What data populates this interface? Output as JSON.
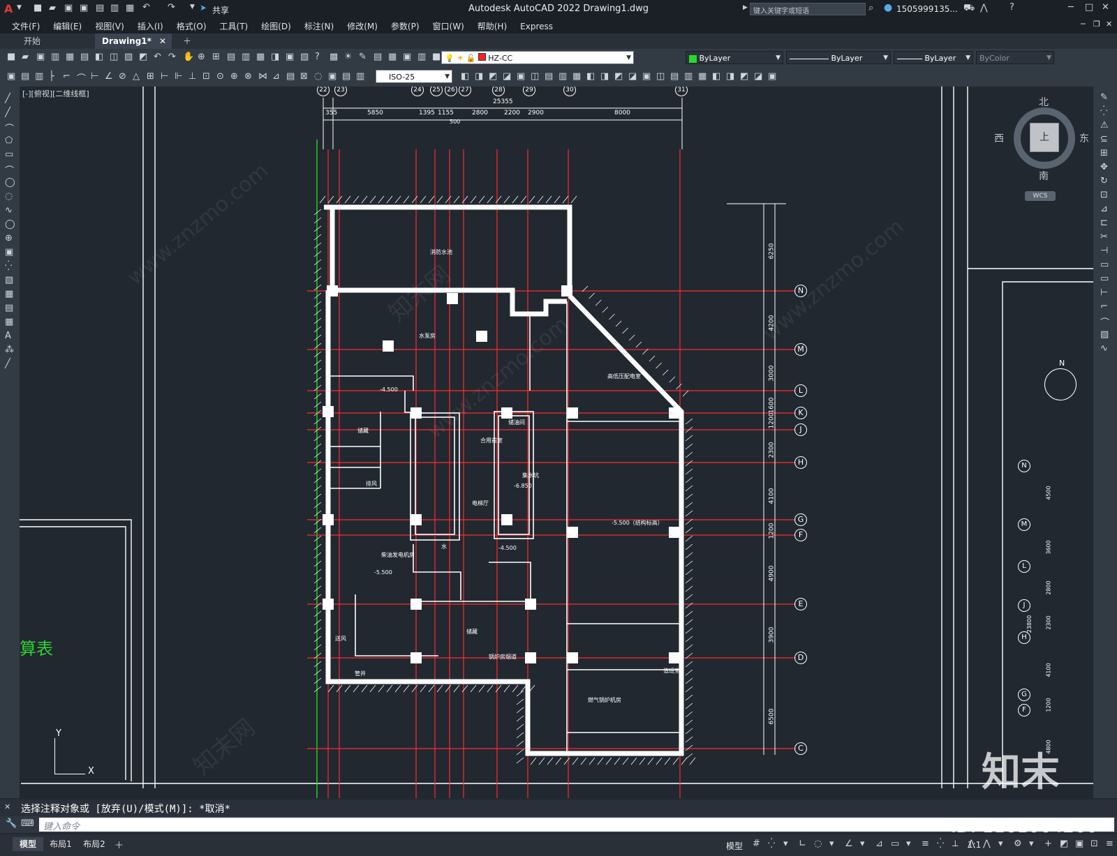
{
  "titlebar": {
    "app_title": "Autodesk AutoCAD 2022    Drawing1.dwg",
    "share_label": "共享",
    "search_placeholder": "键入关键字或短语",
    "user": "1505999135..."
  },
  "menu": [
    "文件(F)",
    "编辑(E)",
    "视图(V)",
    "插入(I)",
    "格式(O)",
    "工具(T)",
    "绘图(D)",
    "标注(N)",
    "修改(M)",
    "参数(P)",
    "窗口(W)",
    "帮助(H)",
    "Express"
  ],
  "tabs": {
    "start": "开始",
    "doc": "Drawing1*"
  },
  "toolbar": {
    "layer_name": "HZ-CC",
    "color": "ByLayer",
    "linetype": "ByLayer",
    "lineweight": "ByLayer",
    "plotstyle": "ByColor",
    "dimstyle": "ISO-25"
  },
  "viewport": {
    "label": "[-][俯视][二维线框]"
  },
  "viewcube": {
    "north": "北",
    "south": "南",
    "east": "东",
    "west": "西",
    "top": "上",
    "wcs": "WCS"
  },
  "drawing": {
    "total_dim": "25355",
    "top_dims": [
      "355",
      "5850",
      "1395",
      "1155",
      "2800",
      "2200",
      "2900",
      "8000"
    ],
    "sub_dim": "500",
    "col_labels": [
      "22",
      "23",
      "24",
      "25",
      "26",
      "27",
      "28",
      "29",
      "30",
      "31"
    ],
    "right_dims": [
      "6250",
      "4200",
      "3000",
      "1600",
      "1200",
      "2300",
      "4100",
      "1200",
      "4900",
      "3900",
      "6500"
    ],
    "row_labels": [
      "N",
      "M",
      "L",
      "K",
      "J",
      "H",
      "G",
      "F",
      "E",
      "D",
      "C"
    ],
    "right_view_rows": [
      "N",
      "M",
      "L",
      "J",
      "H",
      "G",
      "F"
    ],
    "right_view_dims": [
      "4500",
      "3600",
      "2800",
      "2300",
      "4100",
      "1200",
      "4800"
    ],
    "right_view_total": "23800",
    "rooms": [
      "消防水池",
      "水泵房",
      "储藏",
      "高低压配电室",
      "柴油发电机房",
      "锅炉房烟道",
      "储藏",
      "燃气锅炉机房",
      "管井",
      "-4.500",
      "-5.500",
      "-5.500（结构标高）",
      "-6.850",
      "-4.500",
      "电梯厅",
      "合用前室",
      "排风",
      "送风",
      "储油间",
      "值班室",
      "集水坑",
      "水"
    ],
    "left_text": "算表",
    "north_label": "N",
    "ucs_x": "X",
    "ucs_y": "Y"
  },
  "command": {
    "history": "选择注释对象或 [放弃(U)/模式(M)]: *取消*",
    "prompt_placeholder": "键入命令"
  },
  "layout_tabs": [
    "模型",
    "布局1",
    "布局2"
  ],
  "status": {
    "model": "模型",
    "scale": "1:1"
  },
  "watermark": {
    "logo": "知末",
    "id": "ID: 1161064260",
    "url": "www.znzmo.com",
    "cn": "知末网"
  }
}
